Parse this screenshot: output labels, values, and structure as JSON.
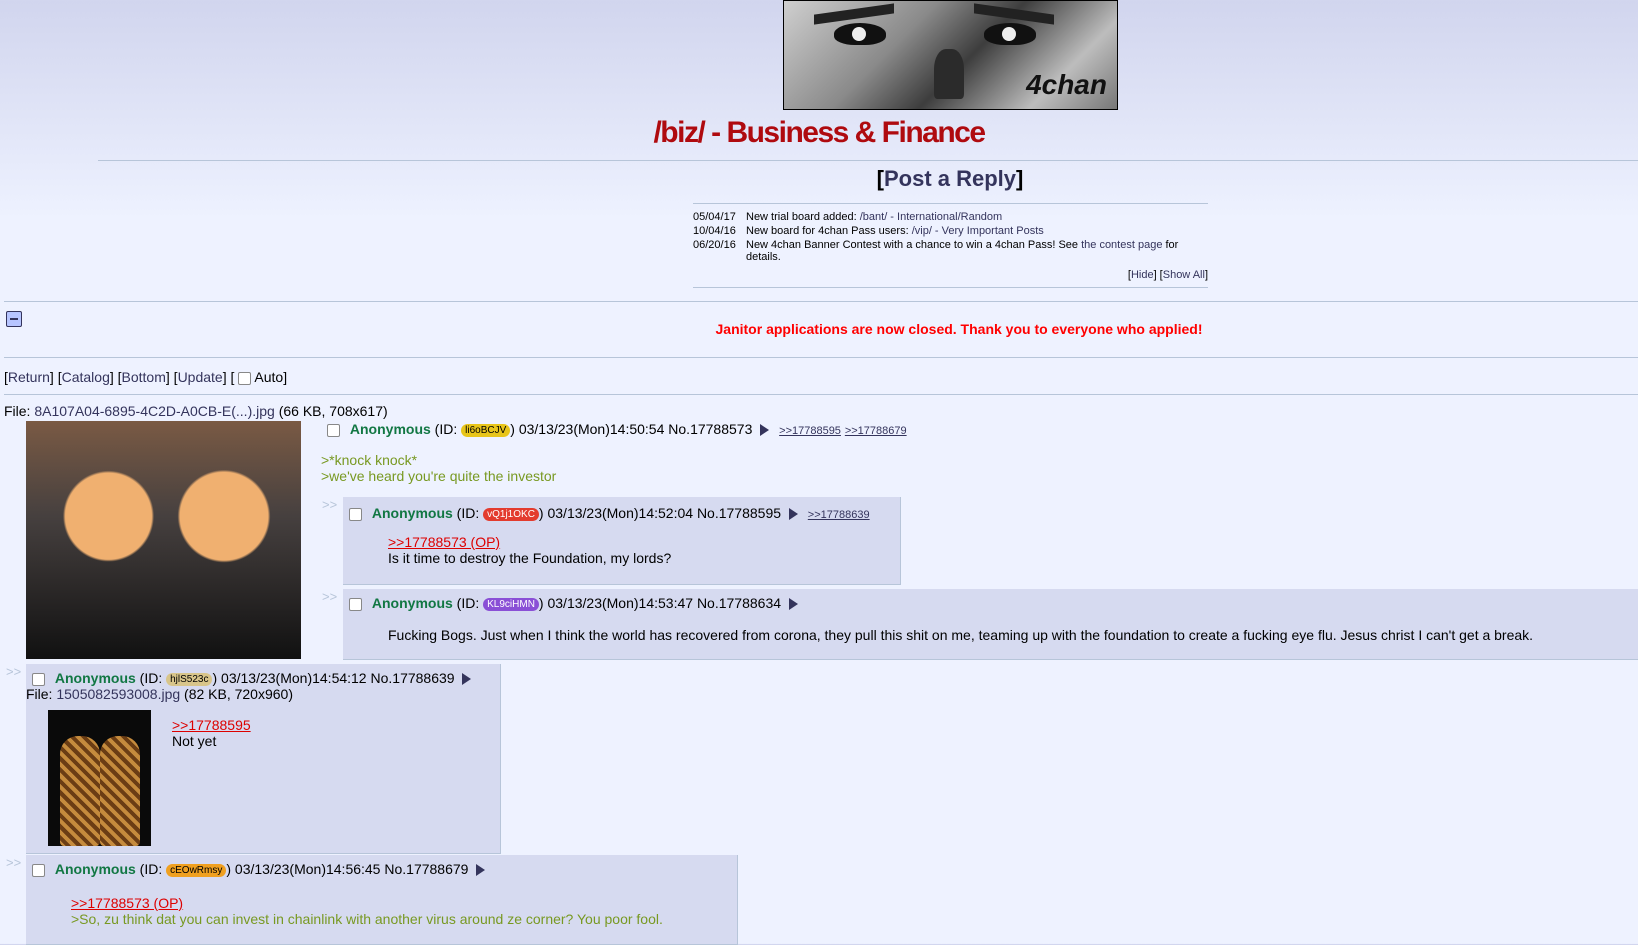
{
  "banner": {
    "text": "4chan",
    "image": "4chan banner art (grayscale face)"
  },
  "board": {
    "title": "/biz/ - Business & Finance"
  },
  "post_reply": {
    "open": "[",
    "label": "Post a Reply",
    "close": "]"
  },
  "news": [
    {
      "date": "05/04/17",
      "text": "New trial board added: ",
      "link": "/bant/ - International/Random",
      "after": ""
    },
    {
      "date": "10/04/16",
      "text": "New board for 4chan Pass users: ",
      "link": "/vip/ - Very Important Posts",
      "after": ""
    },
    {
      "date": "06/20/16",
      "text": "New 4chan Banner Contest with a chance to win a 4chan Pass! See ",
      "link": "the contest page",
      "after": " for details."
    }
  ],
  "news_controls": {
    "hide": "Hide",
    "show_all": "Show All"
  },
  "notice": "Janitor applications are now closed. Thank you to everyone who applied!",
  "nav": {
    "return": "Return",
    "catalog": "Catalog",
    "bottom": "Bottom",
    "update": "Update",
    "auto": "Auto"
  },
  "op": {
    "file_label": "File: ",
    "file_name": "8A107A04-6895-4C2D-A0CB-E(...).jpg",
    "file_meta": " (66 KB, 708x617)",
    "name": "Anonymous",
    "id_prefix": " (ID: ",
    "id": "li6oBCJV",
    "id_suffix": ")",
    "datetime": " 03/13/23(Mon)14:50:54 ",
    "no": "No.17788573",
    "backlinks": [
      ">>17788595",
      ">>17788679"
    ],
    "lines": [
      ">*knock knock*",
      ">we've heard you're quite the investor"
    ]
  },
  "replies": [
    {
      "name": "Anonymous",
      "id": "vQ1j1OKC",
      "id_color": "#e33b2e",
      "datetime": " 03/13/23(Mon)14:52:04 ",
      "no": "No.17788595",
      "backlinks": [
        ">>17788639"
      ],
      "quote_link": ">>17788573 (OP)",
      "text": "Is it time to destroy the Foundation, my lords?"
    },
    {
      "name": "Anonymous",
      "id": "KL9ciHMN",
      "id_color": "#8a4fd6",
      "datetime": " 03/13/23(Mon)14:53:47 ",
      "no": "No.17788634",
      "text": "Fucking Bogs. Just when I think the world has recovered from corona, they pull this shit on me, teaming up with the foundation to create a fucking eye flu. Jesus christ I can't get a break."
    },
    {
      "name": "Anonymous",
      "id": "hjlS523c",
      "id_color": "#d8c58a",
      "datetime": " 03/13/23(Mon)14:54:12 ",
      "no": "No.17788639",
      "file_label": "File: ",
      "file_name": "1505082593008.jpg",
      "file_meta": " (82 KB, 720x960)",
      "quote_link": ">>17788595",
      "text": "Not yet"
    },
    {
      "name": "Anonymous",
      "id": "cEOwRmsy",
      "id_color": "#f0a020",
      "datetime": " 03/13/23(Mon)14:56:45 ",
      "no": "No.17788679",
      "quote_link": ">>17788573 (OP)",
      "greentext": ">So, zu think dat you can invest in chainlink with another virus around ze corner? You poor fool."
    }
  ],
  "side_arrows": ">>"
}
